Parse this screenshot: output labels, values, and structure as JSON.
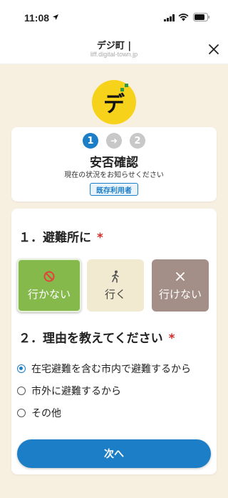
{
  "status_bar": {
    "time": "11:08"
  },
  "nav": {
    "title": "デジ町 |",
    "url": "liff.digital-town.jp"
  },
  "logo": {
    "text": "デ",
    "color": "#f7d21b"
  },
  "steps": {
    "step1": "1",
    "arrow": "➜",
    "step2": "2",
    "title": "安否確認",
    "subtitle": "現在の状況をお知らせください",
    "badge": "既存利用者"
  },
  "question1": {
    "label": "１．避難所に",
    "required": "*",
    "choices": [
      {
        "label": "行かない",
        "icon": "no-entry-icon",
        "selected": true,
        "color": "#86b94c"
      },
      {
        "label": "行く",
        "icon": "walking-person-icon",
        "selected": false,
        "color": "#f2ead0"
      },
      {
        "label": "行けない",
        "icon": "cross-icon",
        "selected": false,
        "color": "#a38f87"
      }
    ]
  },
  "question2": {
    "label": "２．理由を教えてください",
    "required": "*",
    "options": [
      {
        "label": "在宅避難を含む市内で避難するから",
        "selected": true
      },
      {
        "label": "市外に避難するから",
        "selected": false
      },
      {
        "label": "その他",
        "selected": false
      }
    ]
  },
  "next_button": "次へ",
  "colors": {
    "accent": "#1c7ec7",
    "required": "#d62b2b",
    "background": "#f7efe0"
  }
}
